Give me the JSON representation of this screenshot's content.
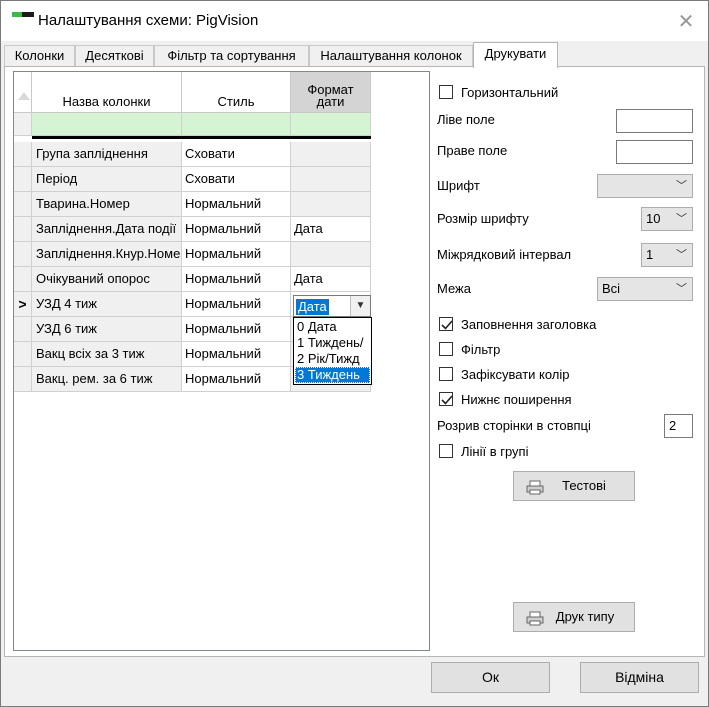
{
  "window": {
    "title": "Налаштування схеми: PigVision"
  },
  "tabs": [
    {
      "label": "Колонки",
      "active": false
    },
    {
      "label": "Десяткові",
      "active": false
    },
    {
      "label": "Фільтр та сортування",
      "active": false
    },
    {
      "label": "Налаштування колонок",
      "active": false
    },
    {
      "label": "Друкувати",
      "active": true
    }
  ],
  "grid": {
    "headers": [
      "Назва колонки",
      "Стиль",
      "Формат дати"
    ],
    "header_sel_lines": [
      "Формат",
      "дати"
    ],
    "rows": [
      {
        "name": "Група запліднення",
        "style": "Сховати",
        "fmt": ""
      },
      {
        "name": "Період",
        "style": "Сховати",
        "fmt": ""
      },
      {
        "name": "Тварина.Номер",
        "style": "Нормальний",
        "fmt": ""
      },
      {
        "name": "Запліднення.Дата події",
        "style": "Нормальний",
        "fmt": "Дата"
      },
      {
        "name": "Запліднення.Кнур.Номер",
        "style": "Нормальний",
        "fmt": ""
      },
      {
        "name": "Очікуваний опорос",
        "style": "Нормальний",
        "fmt": "Дата"
      },
      {
        "name": "УЗД 4 тиж",
        "style": "Нормальний",
        "fmt": "Дата"
      },
      {
        "name": "УЗД 6 тиж",
        "style": "Нормальний",
        "fmt": ""
      },
      {
        "name": "Вакц всіх за 3 тиж",
        "style": "Нормальний",
        "fmt": ""
      },
      {
        "name": "Вакц. рем. за 6 тиж",
        "style": "Нормальний",
        "fmt": ""
      }
    ],
    "current_row_marker": ">",
    "editor_value": "Дата",
    "dropdown_options": [
      "0 Дата",
      "1 Тиждень/",
      "2 Рік/Тижд",
      "3 Тиждень"
    ],
    "dropdown_selected_index": 3
  },
  "print": {
    "horizontal": {
      "label": "Горизонтальний",
      "checked": false
    },
    "left_margin": {
      "label": "Ліве поле",
      "value": ""
    },
    "right_margin": {
      "label": "Праве поле",
      "value": ""
    },
    "font": {
      "label": "Шрифт",
      "value": ""
    },
    "font_size": {
      "label": "Розмір шрифту",
      "value": "10"
    },
    "line_spacing": {
      "label": "Міжрядковий інтервал",
      "value": "1"
    },
    "border": {
      "label": "Межа",
      "value": "Всі"
    },
    "fill_header": {
      "label": "Заповнення заголовка",
      "checked": true
    },
    "filter": {
      "label": "Фільтр",
      "checked": false
    },
    "fix_color": {
      "label": "Зафіксувати колір",
      "checked": false
    },
    "bottom_spread": {
      "label": "Нижнє поширення",
      "checked": true
    },
    "page_break": {
      "label": "Розрив сторінки в стовпці",
      "value": "2"
    },
    "group_lines": {
      "label": "Лінії в групі",
      "checked": false
    },
    "test_button": "Тестові",
    "print_type_button": "Друк типу"
  },
  "footer": {
    "ok": "Ок",
    "cancel": "Відміна"
  }
}
